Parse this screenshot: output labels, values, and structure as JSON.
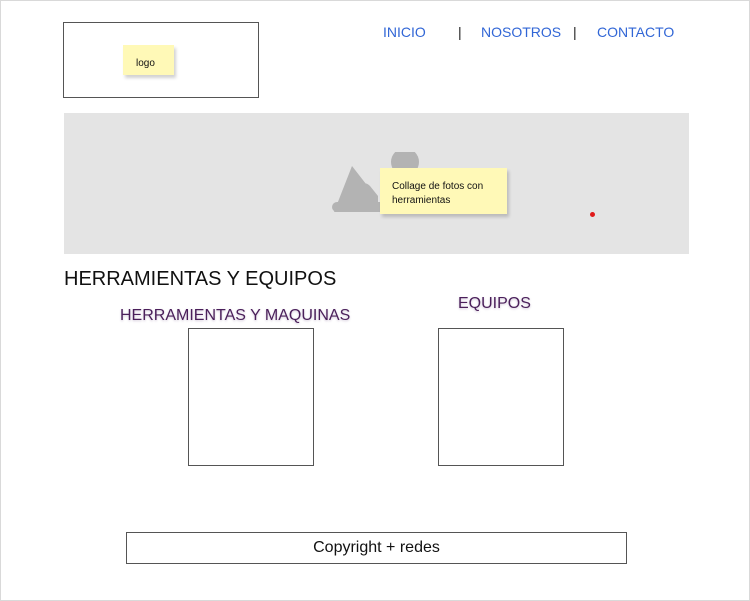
{
  "header": {
    "logo_label": "logo",
    "nav": {
      "items": [
        "INICIO",
        "NOSOTROS",
        "CONTACTO"
      ],
      "separator": "|"
    }
  },
  "hero": {
    "image_icon": "image-placeholder-icon",
    "note": "Collage de fotos con herramientas"
  },
  "section": {
    "title": "HERRAMIENTAS Y EQUIPOS",
    "left_title": "HERRAMIENTAS Y MAQUINAS",
    "right_title": "EQUIPOS"
  },
  "footer": {
    "text": "Copyright + redes"
  },
  "colors": {
    "nav_link": "#3166d6",
    "sticky_note": "#fff9b7",
    "hero_bg": "#e4e4e4",
    "subtitle": "#4a1f5a",
    "marker": "#e01a1a"
  }
}
